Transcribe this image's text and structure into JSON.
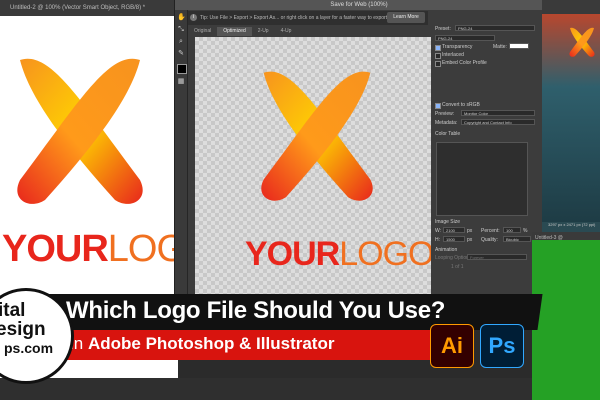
{
  "left_window": {
    "tab_title": "Untitled-2 @ 100% (Vector Smart Object, RGB/8) *",
    "logo_text_bold": "YOUR",
    "logo_text_light": "LOGO"
  },
  "dialog": {
    "title": "Save for Web (100%)",
    "tip": "Tip: Use File > Export > Export As... or right click on a layer for a faster way to export assets",
    "learn_more": "Learn More",
    "tabs": [
      "Original",
      "Optimized",
      "2-Up",
      "4-Up"
    ],
    "logo_text_bold": "YOUR",
    "logo_text_light": "LOGO"
  },
  "settings": {
    "preset_label": "Preset:",
    "preset_value": "PNG-24",
    "format_value": "PNG-24",
    "transparency": "Transparency",
    "matte_label": "Matte:",
    "interlaced": "Interlaced",
    "embed_profile": "Embed Color Profile",
    "convert_srgb": "Convert to sRGB",
    "preview_label": "Preview:",
    "preview_value": "Monitor Color",
    "metadata_label": "Metadata:",
    "metadata_value": "Copyright and Contact Info",
    "color_table": "Color Table",
    "image_size": "Image Size",
    "w_label": "W:",
    "w_value": "2100",
    "h_label": "H:",
    "h_value": "1500",
    "px": "px",
    "percent_label": "Percent:",
    "percent_value": "100",
    "pct": "%",
    "quality_label": "Quality:",
    "quality_value": "Bicubic",
    "animation": "Animation",
    "looping_label": "Looping Options:",
    "looping_value": "Forever",
    "frame_counter": "1 of 1"
  },
  "right_window": {
    "info1": "3297 px x 2471 px (72 ppi)",
    "title2": "Untitled-3 @"
  },
  "banner": {
    "headline": "Which Logo File Should You Use?",
    "sub_prefix": "in ",
    "sub_bold": "Adobe Photoshop & Illustrator",
    "badge_line1": "ital",
    "badge_line2": "esign",
    "badge_line3": "ps.com"
  },
  "apps": {
    "illustrator": "Ai",
    "photoshop": "Ps"
  },
  "colors": {
    "logo_orange": "#f7931e",
    "logo_red": "#e8261c",
    "logo_yellow": "#ffd400",
    "banner_red": "#d8140e",
    "ai_brand": "#ff9a00",
    "ps_brand": "#31a8ff"
  },
  "icons": [
    "hand-icon",
    "slice-select-icon",
    "zoom-icon",
    "eyedropper-icon",
    "eyedropper-color-swatch",
    "toggle-slices-icon",
    "info-icon"
  ]
}
